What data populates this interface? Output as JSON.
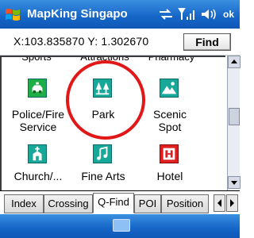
{
  "title_bar": {
    "app_title": "MapKing Singapo",
    "ok_label": "ok",
    "icons": [
      "windows-start-icon",
      "connectivity-icon",
      "signal-icon",
      "volume-icon"
    ]
  },
  "coords": {
    "text": "X:103.835870 Y: 1.302670",
    "find_label": "Find"
  },
  "categories_partial": [
    "Sports",
    "Attractions",
    "Pharmacy"
  ],
  "categories": [
    {
      "label_lines": [
        "Police/Fire",
        "Service"
      ],
      "icon": "police-car-icon"
    },
    {
      "label_lines": [
        "Park"
      ],
      "icon": "park-trees-icon"
    },
    {
      "label_lines": [
        "Scenic",
        "Spot"
      ],
      "icon": "scenic-mountain-icon"
    },
    {
      "label_lines": [
        "Church/..."
      ],
      "icon": "church-icon"
    },
    {
      "label_lines": [
        "Fine Arts"
      ],
      "icon": "music-note-icon"
    },
    {
      "label_lines": [
        "Hotel"
      ],
      "icon": "hotel-icon"
    }
  ],
  "tabs": [
    "Index",
    "Crossing",
    "Q-Find",
    "POI",
    "Position"
  ],
  "active_tab": "Q-Find",
  "colors": {
    "titlebar": "#1565c7",
    "icon_teal": "#17a89a",
    "icon_green": "#1fae46",
    "hotel_red": "#e02020",
    "annotation_red": "#e01818"
  }
}
